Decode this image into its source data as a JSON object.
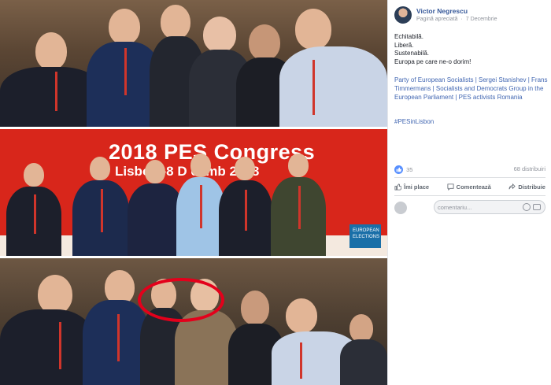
{
  "post": {
    "author": "Victor Negrescu",
    "page_label": "Pagină apreciată",
    "date": "7 Decembrie",
    "lines": [
      "Echitabilă.",
      "Liberă.",
      "Sustenabilă.",
      "Europa pe care ne-o dorim!"
    ],
    "tags_text": "Party of European Socialists | Sergei Stanishev | Frans Timmermans | Socialists and Democrats Group in the European Parliament | PES activists Romania",
    "hashtag": "#PESinLisbon"
  },
  "photos": {
    "banner_title": "2018 PES Congress",
    "banner_subtitle": "Lisbo 1-8 D cemb 2018",
    "corner_logo": "EUROPEAN ELECTIONS"
  },
  "stats": {
    "reactions": "35",
    "shares": "68 distribuiri"
  },
  "actions": {
    "like": "Îmi place",
    "comment": "Comentează",
    "share": "Distribuie"
  },
  "comment": {
    "placeholder": "comentariu..."
  },
  "colors": {
    "link": "#365899",
    "banner": "#d8261b",
    "highlight_ring": "#e3001b"
  }
}
